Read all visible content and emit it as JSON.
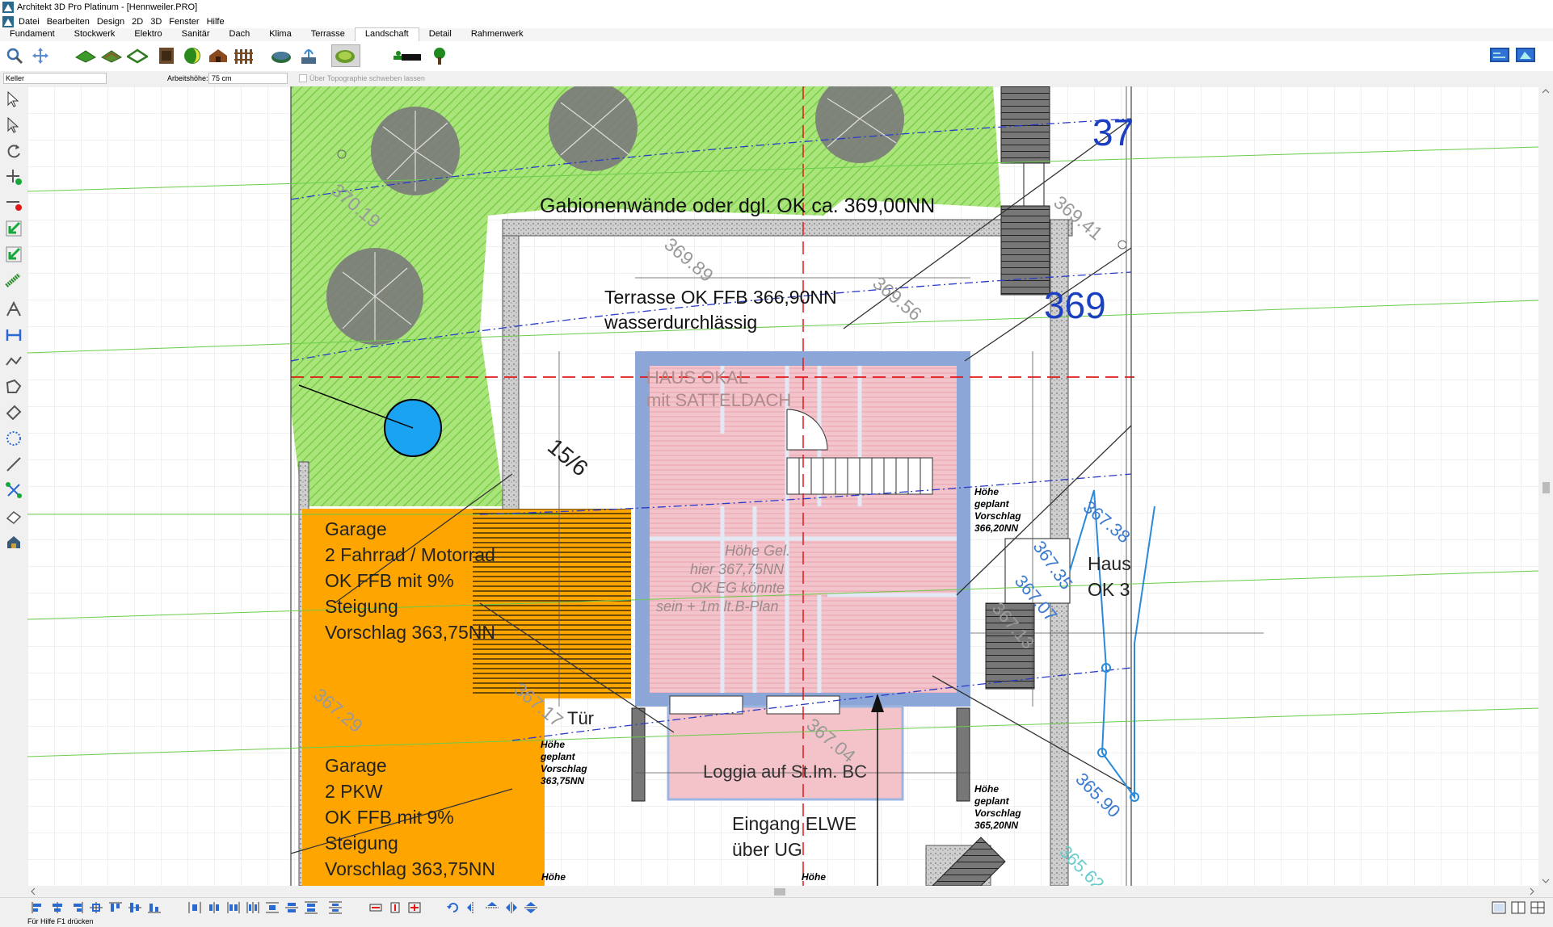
{
  "window": {
    "title": "Architekt 3D Pro Platinum - [Hennweiler.PRO]"
  },
  "menu": [
    "Datei",
    "Bearbeiten",
    "Design",
    "2D",
    "3D",
    "Fenster",
    "Hilfe"
  ],
  "tabs": [
    {
      "label": "Fundament"
    },
    {
      "label": "Stockwerk"
    },
    {
      "label": "Elektro"
    },
    {
      "label": "Sanitär"
    },
    {
      "label": "Dach"
    },
    {
      "label": "Klima"
    },
    {
      "label": "Terrasse"
    },
    {
      "label": "Landschaft",
      "active": true
    },
    {
      "label": "Detail"
    },
    {
      "label": "Rahmenwerk"
    }
  ],
  "ribbon_icons": [
    "zoom-icon",
    "pan-icon",
    "terrain-flat-icon",
    "terrain-slope-icon",
    "terrain-outline-icon",
    "cabinet-icon",
    "pool-icon",
    "shed-icon",
    "fence-icon",
    "pond-icon",
    "fountain-icon",
    "plant-bed-icon",
    "path-icon",
    "tree-icon",
    "view-2d-icon",
    "view-3d-icon"
  ],
  "properties": {
    "floor": "Keller",
    "working_height_label": "Arbeitshöhe:",
    "working_height_value": "75 cm",
    "float_label": "Über Topographie schweben lassen"
  },
  "plan_labels": {
    "gabion": "Gabionenwände oder dgl. OK ca. 369,00NN",
    "terrace_1": "Terrasse OK FFB 366,90NN",
    "terrace_2": "wasserdurchlässig",
    "haus_1": "HAUS OKAL",
    "haus_2": "mit SATTELDACH",
    "height_1": "Höhe Gel.",
    "height_2": "hier 367,75NN",
    "height_3": "OK EG könnte",
    "height_4": "sein + 1m lt.B-Plan",
    "garage1_1": "Garage",
    "garage1_2": "2 Fahrrad / Motorrad",
    "garage1_3": "OK FFB mit 9%",
    "garage1_4": "Steigung",
    "garage1_5": "Vorschlag 363,75NN",
    "garage2_1": "Garage",
    "garage2_2": "2 PKW",
    "garage2_3": "OK FFB mit 9%",
    "garage2_4": "Steigung",
    "garage2_5": "Vorschlag 363,75NN",
    "tuer": "Tür",
    "loggia": "Loggia auf St.Im. BC",
    "entry_1": "Eingang ELWE",
    "entry_2": "über UG",
    "hoehe_a1": "Höhe",
    "hoehe_a2": "geplant",
    "hoehe_a3": "Vorschlag",
    "hoehe_a4": "363,75NN",
    "hoehe_b1": "Höhe",
    "hoehe_b2": "geplant",
    "hoehe_b3": "Vorschlag",
    "hoehe_b4": "366,20NN",
    "hoehe_c1": "Höhe",
    "hoehe_c2": "geplant",
    "hoehe_c3": "Vorschlag",
    "hoehe_c4": "365,20NN",
    "hoehe_d1": "Höhe",
    "hoehe_e1": "Höhe",
    "haus_r1": "Haus",
    "haus_r2": "OK 3",
    "scale": "15/6",
    "contour_370": "370.19",
    "contour_36989": "369.89",
    "contour_36956": "369.56",
    "contour_36941": "369.41",
    "contour_36729": "367.29",
    "contour_36717": "367.17",
    "contour_36704": "367.04",
    "contour_36738": "367.38",
    "contour_36735": "367.35",
    "contour_36707": "367.07",
    "contour_36713": "367.13",
    "contour_36590": "365.90",
    "contour_36562": "365.62",
    "big_37": "37",
    "big_369": "369"
  },
  "status": "Für Hilfe F1 drücken",
  "colors": {
    "accent": "#1a3fc0",
    "garage": "#ffa500",
    "house_wall": "#8da6d8",
    "house_fill": "#f6c6cc",
    "grass": "#9be36a",
    "pool": "#1aa3f0"
  }
}
